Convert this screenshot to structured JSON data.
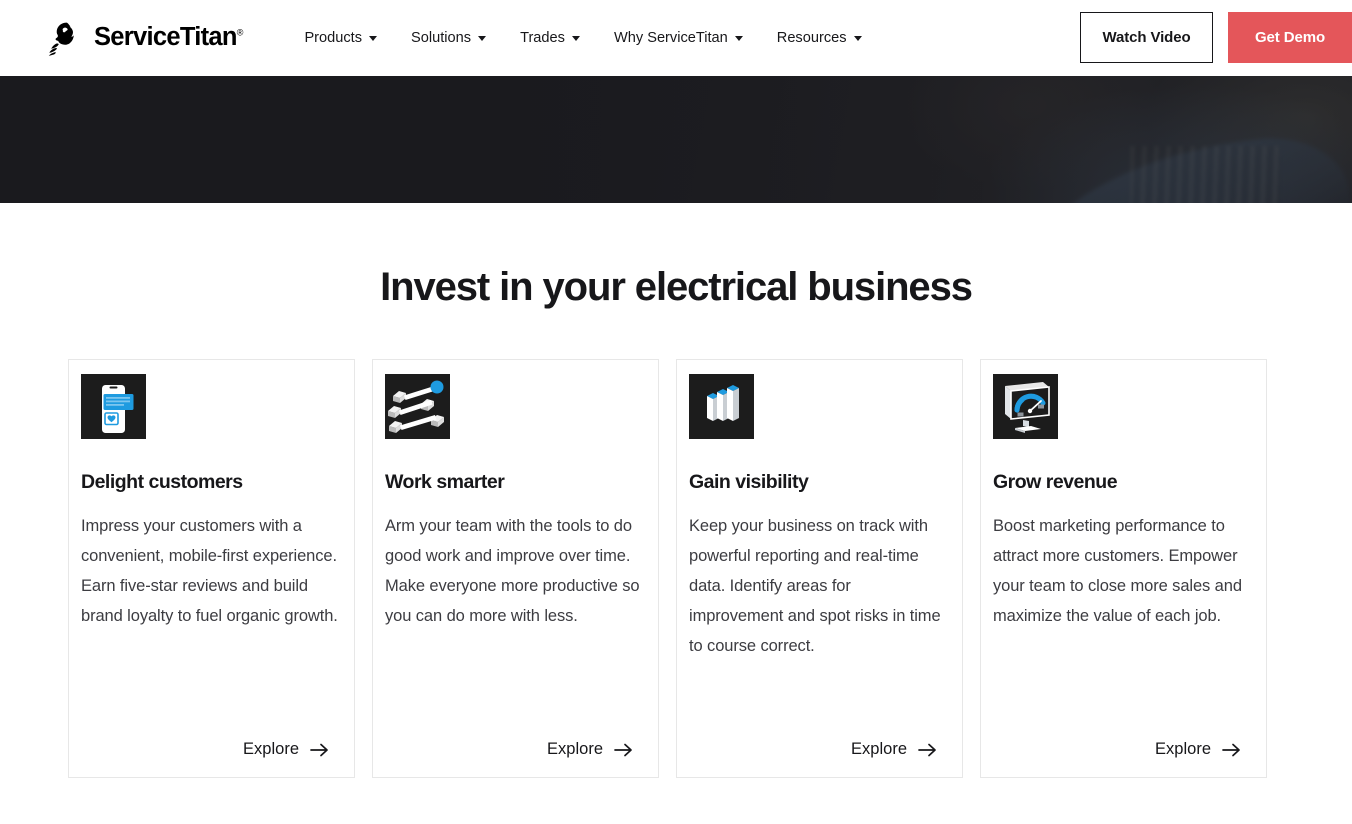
{
  "header": {
    "brand": {
      "name": "ServiceTitan",
      "registered": "®",
      "logo_icon": "titan-head-logo"
    },
    "nav": [
      {
        "label": "Products",
        "icon": "chevron-down-icon"
      },
      {
        "label": "Solutions",
        "icon": "chevron-down-icon"
      },
      {
        "label": "Trades",
        "icon": "chevron-down-icon"
      },
      {
        "label": "Why ServiceTitan",
        "icon": "chevron-down-icon"
      },
      {
        "label": "Resources",
        "icon": "chevron-down-icon"
      }
    ],
    "watch_video_label": "Watch Video",
    "get_demo_label": "Get Demo",
    "accent_color": "#e4565a"
  },
  "hero": {
    "background_color": "#232327",
    "image_description": "dark photo of technician"
  },
  "main": {
    "title": "Invest in your electrical business",
    "cards": [
      {
        "icon": "mobile-chat-heart-icon",
        "title": "Delight customers",
        "body": "Impress your customers with a convenient, mobile-first experience. Earn five-star reviews and build brand loyalty to fuel organic growth.",
        "cta_label": "Explore",
        "cta_icon": "arrow-right-icon"
      },
      {
        "icon": "network-nodes-icon",
        "title": "Work smarter",
        "body": "Arm your team with the tools to do good work and improve over time. Make everyone more productive so you can do more with less.",
        "cta_label": "Explore",
        "cta_icon": "arrow-right-icon"
      },
      {
        "icon": "bar-chart-3d-icon",
        "title": "Gain visibility",
        "body": "Keep your business on track with powerful reporting and real-time data. Identify areas for improvement and spot risks in time to course correct.",
        "cta_label": "Explore",
        "cta_icon": "arrow-right-icon"
      },
      {
        "icon": "monitor-gauge-icon",
        "title": "Grow revenue",
        "body": "Boost marketing performance to attract more customers. Empower your team to close more sales and maximize the value of each job.",
        "cta_label": "Explore",
        "cta_icon": "arrow-right-icon"
      }
    ],
    "icon_accent_color": "#1e9be0"
  }
}
